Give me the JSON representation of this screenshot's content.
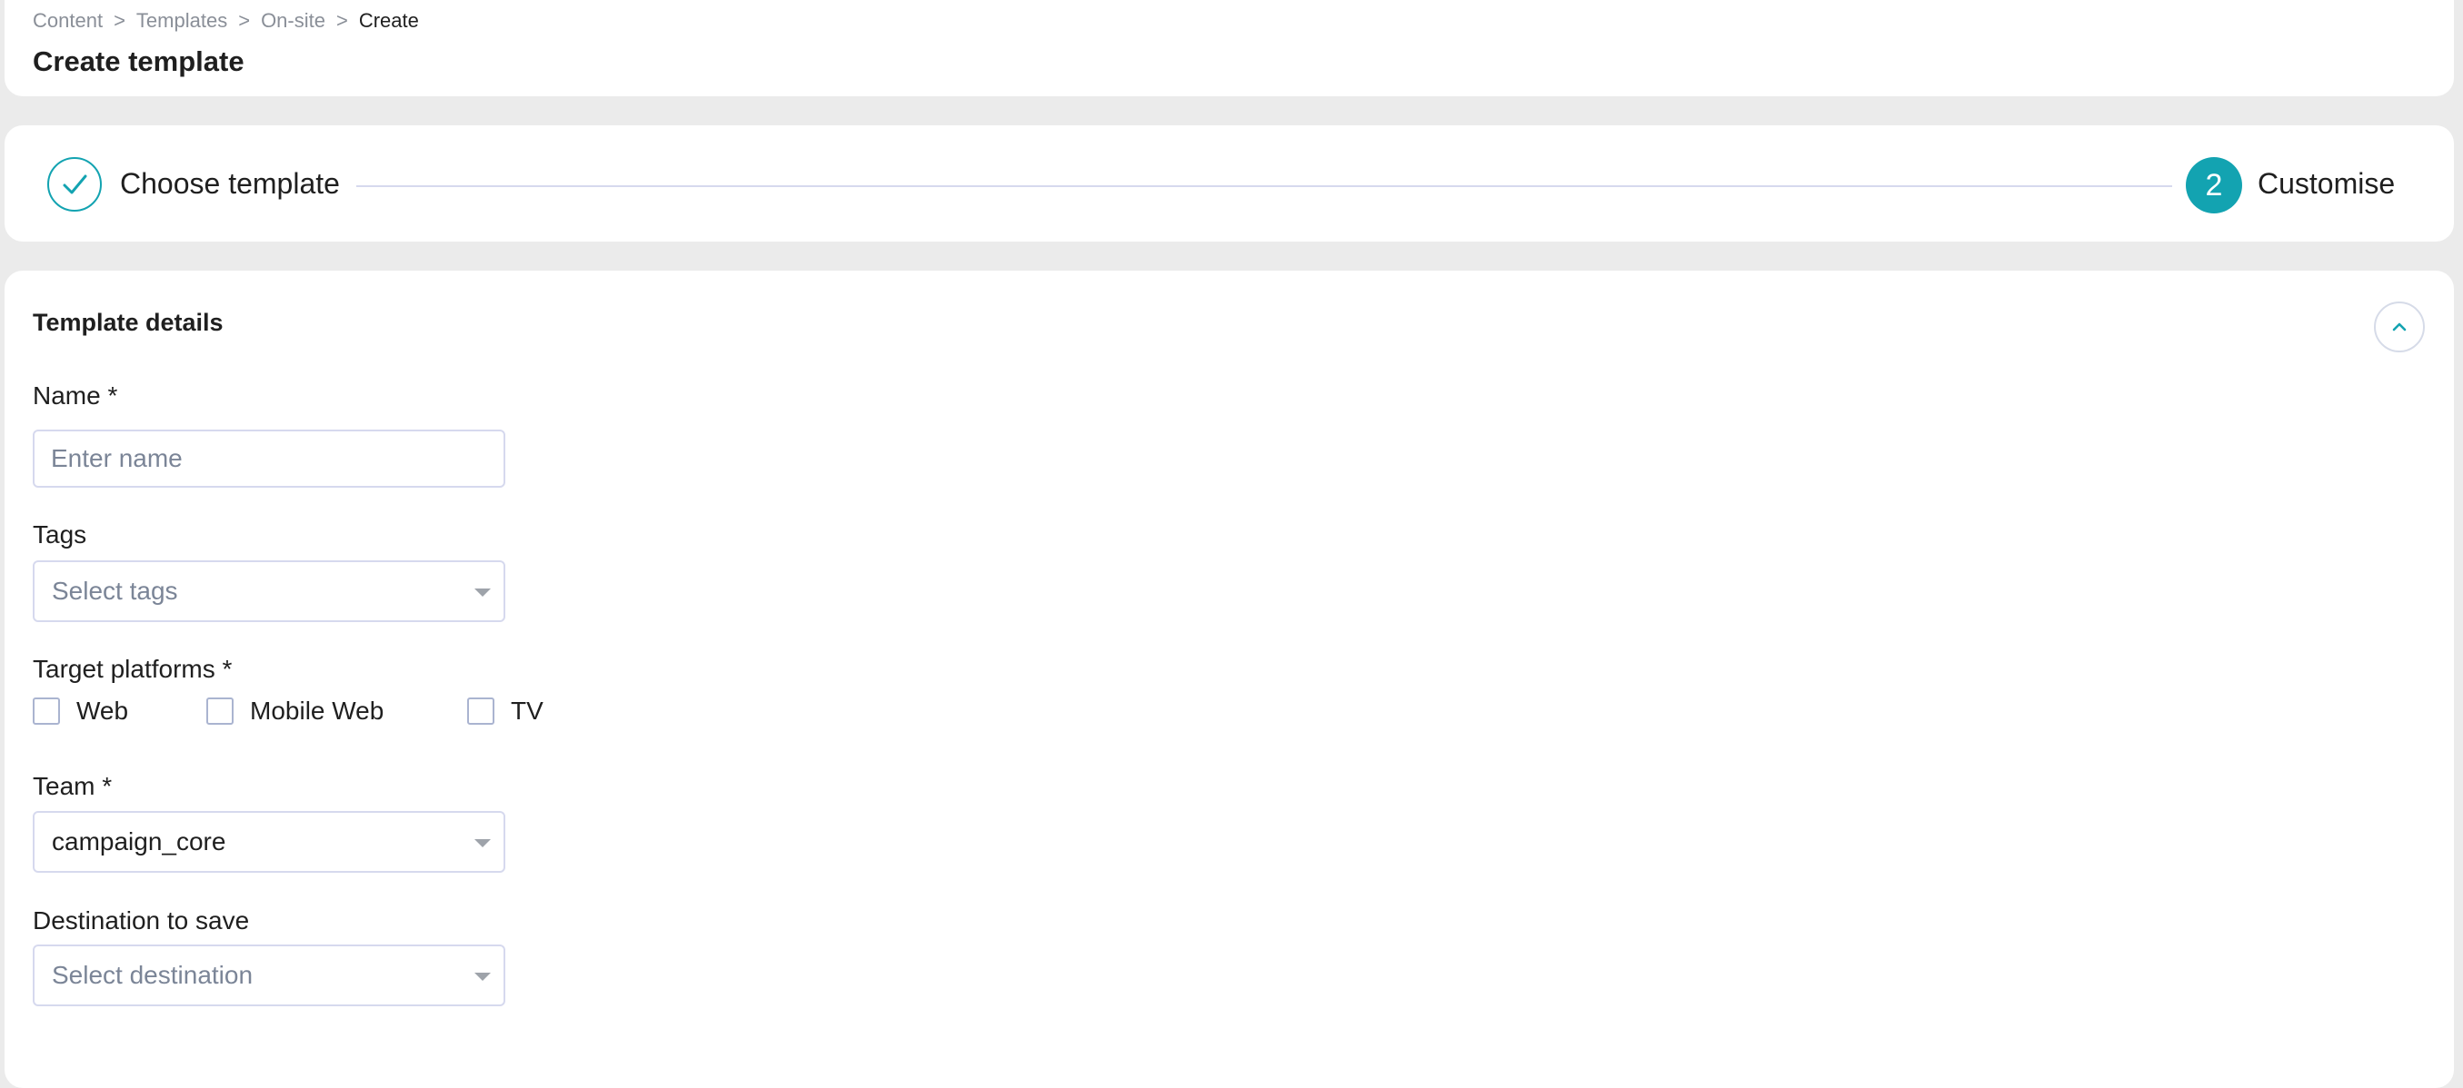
{
  "breadcrumb": {
    "items": [
      "Content",
      "Templates",
      "On-site"
    ],
    "current": "Create",
    "separator": ">"
  },
  "page_title": "Create template",
  "stepper": {
    "steps": [
      {
        "label": "Choose template",
        "status": "completed",
        "icon": "check-icon"
      },
      {
        "label": "Customise",
        "status": "active",
        "number": "2"
      }
    ],
    "accent_color": "#13a3b1"
  },
  "form": {
    "section_title": "Template details",
    "collapse_icon": "chevron-up-icon",
    "name": {
      "label": "Name *",
      "placeholder": "Enter name",
      "value": ""
    },
    "tags": {
      "label": "Tags",
      "placeholder": "Select tags"
    },
    "platforms": {
      "label": "Target platforms *",
      "options": [
        {
          "label": "Web",
          "checked": false
        },
        {
          "label": "Mobile Web",
          "checked": false
        },
        {
          "label": "TV",
          "checked": false
        }
      ]
    },
    "team": {
      "label": "Team *",
      "value": "campaign_core"
    },
    "destination": {
      "label": "Destination to save",
      "placeholder": "Select destination"
    }
  }
}
